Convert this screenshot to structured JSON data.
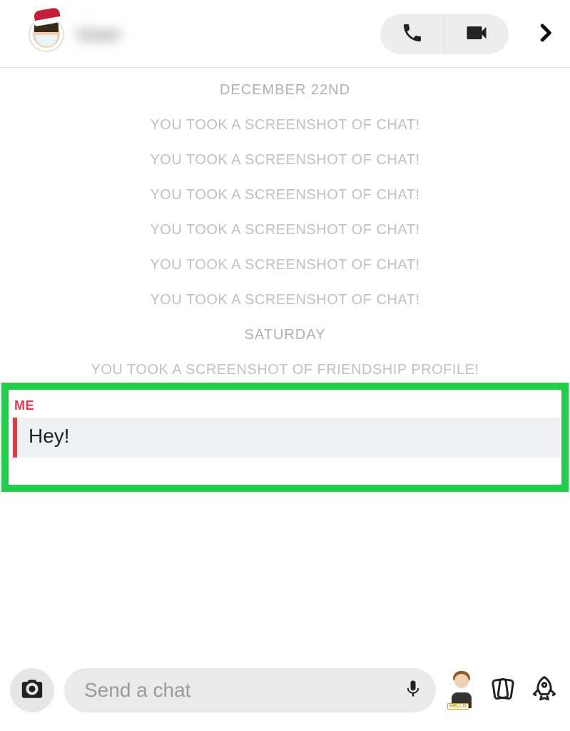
{
  "header": {
    "username": "User"
  },
  "chat": {
    "sections": [
      {
        "date": "DECEMBER 22ND",
        "messages": [
          "YOU TOOK A SCREENSHOT OF CHAT!",
          "YOU TOOK A SCREENSHOT OF CHAT!",
          "YOU TOOK A SCREENSHOT OF CHAT!",
          "YOU TOOK A SCREENSHOT OF CHAT!",
          "YOU TOOK A SCREENSHOT OF CHAT!",
          "YOU TOOK A SCREENSHOT OF CHAT!"
        ]
      },
      {
        "date": "SATURDAY",
        "messages": [
          "YOU TOOK A SCREENSHOT OF FRIENDSHIP PROFILE!"
        ]
      }
    ],
    "my_message": {
      "sender": "ME",
      "text": "Hey!"
    }
  },
  "footer": {
    "placeholder": "Send a chat"
  },
  "colors": {
    "accent_red": "#e63946",
    "highlight_green": "#1fce4a"
  }
}
